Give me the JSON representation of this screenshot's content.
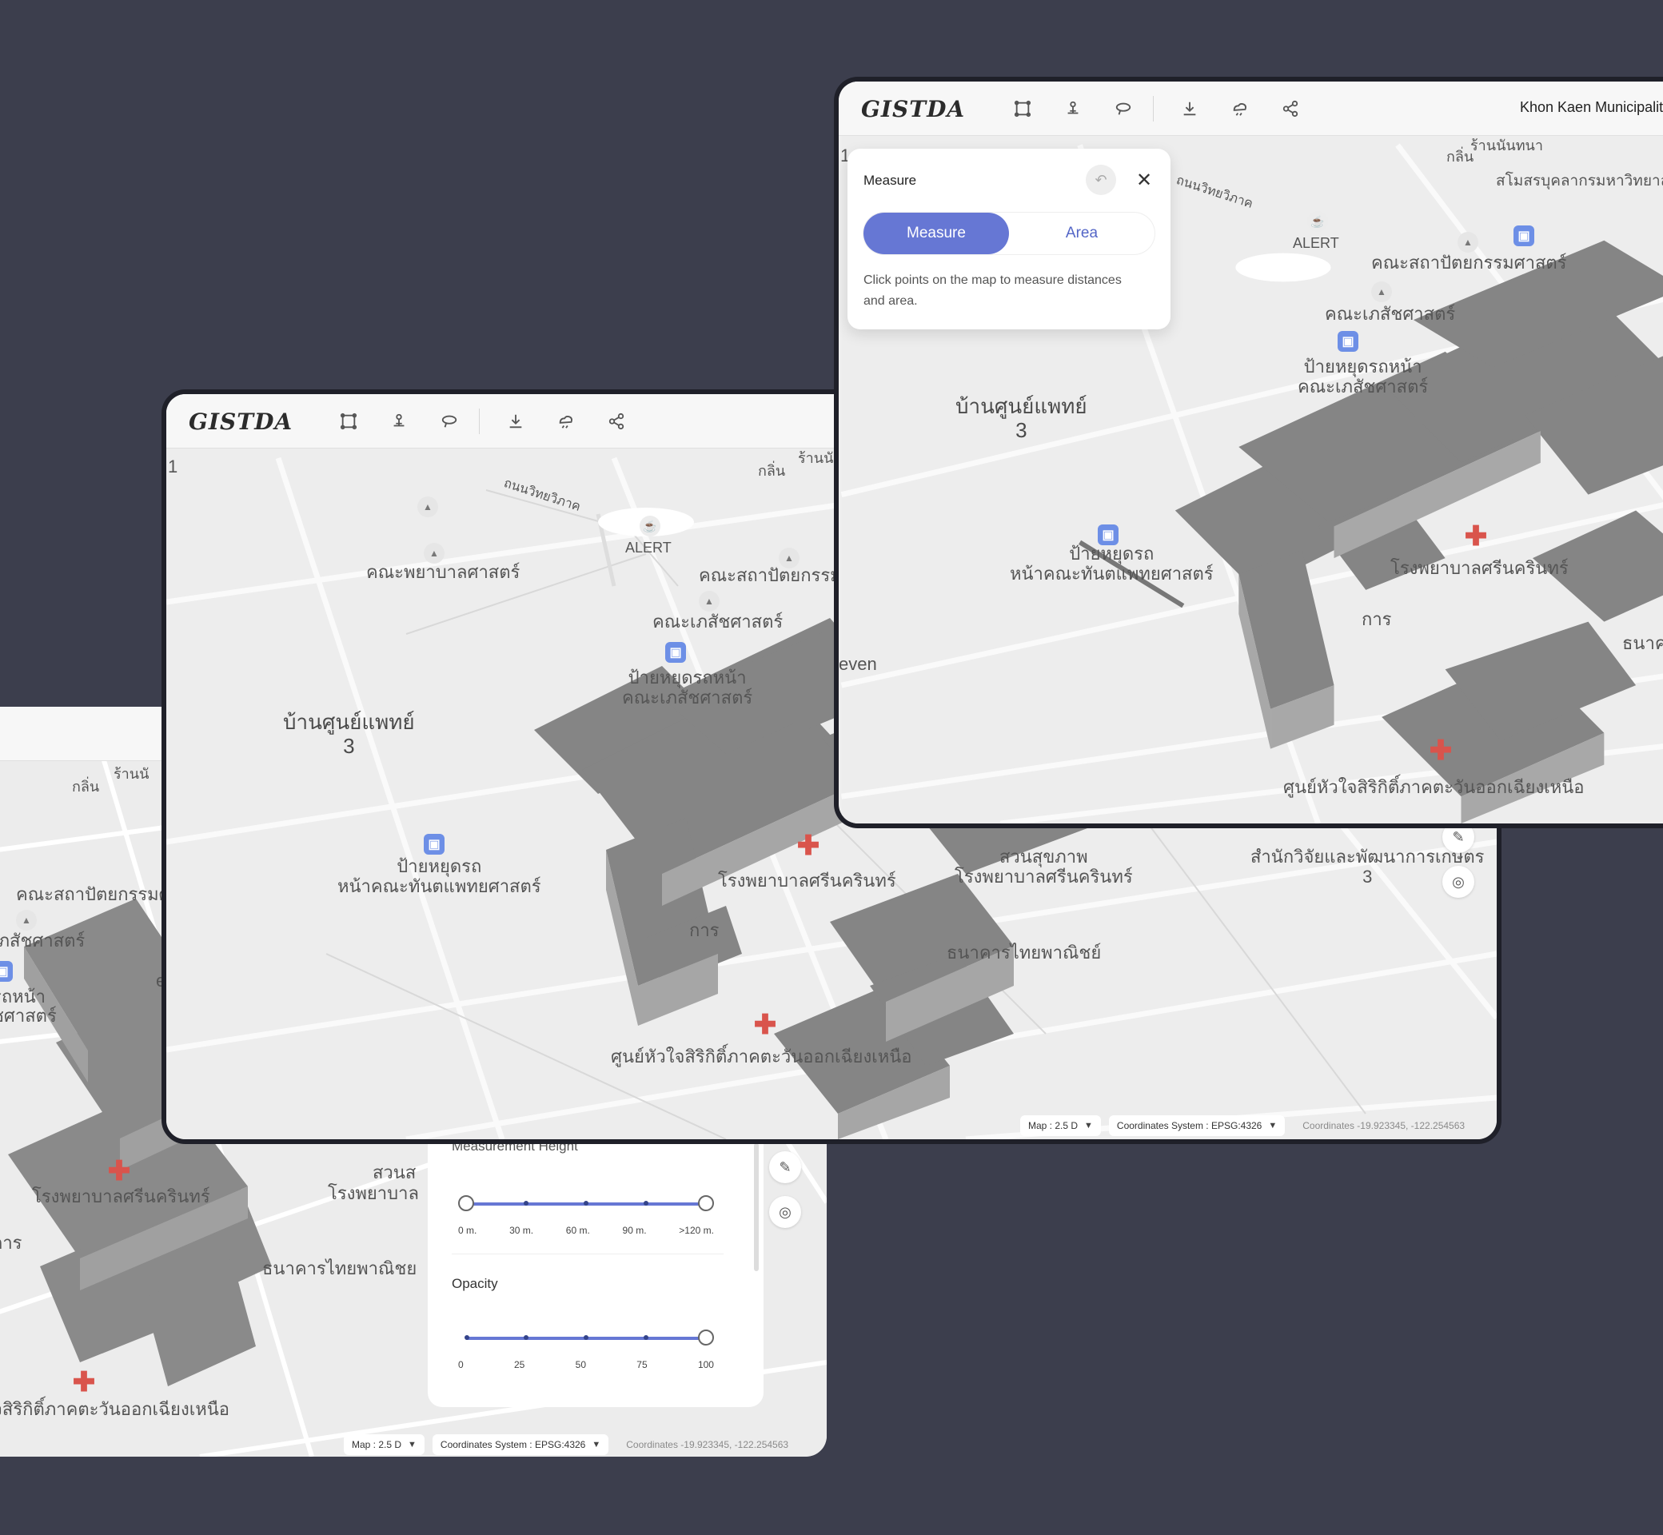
{
  "app": {
    "logo_text": "GISTDA",
    "region": "Khon Kaen Municipalit"
  },
  "toolbar": [
    "select-area-icon",
    "pin-icon",
    "lasso-icon",
    "download-icon",
    "weather-icon",
    "share-icon"
  ],
  "status": {
    "map_mode": "Map : 2.5 D",
    "coord_system": "Coordinates System : EPSG:4326",
    "coords": "Coordinates    -19.923345, -122.254563"
  },
  "map_labels": {
    "ban_sun_phaet": "บ้านศูนย์แพทย์",
    "ban_sun_phaet_num": "3",
    "alert": "ALERT",
    "khana_payaban": "คณะพยาบาลศาสตร์",
    "khana_sathapat": "คณะสถาปัตยกรรมศาสตร์",
    "khana_sathapat_cut": "คณะสถาปัตยกรรมศ",
    "khana_phesat": "คณะเภสัชศาสตร์",
    "bus_stop_phesat_1": "ป้ายหยุดรถหน้า",
    "bus_stop_phesat_2": "คณะเภสัชศาสตร์",
    "bus_stop_dent_1": "ป้ายหยุดรถ",
    "bus_stop_dent_2": "หน้าคณะทันตแพทยศาสตร์",
    "srinagarind": "โรงพยาบาลศรีนครินทร์",
    "heart_center": "ศูนย์หัวใจสิริกิติ์ภาคตะวันออกเฉียงเหนือ",
    "heart_center_cut": "จสิริกิติ์ภาคตะวันออกเฉียงเหนือ",
    "park_1": "สวนสุขภาพ",
    "park_2": "โรงพยาบาลศรีนครินทร์",
    "research": "สำนักวิจัยและพัฒนาการเกษตร",
    "research_num": "3",
    "thai_bank": "ธนาคารไทยพาณิชย์",
    "thai_bank_cut": "ธนาคารไทยพาณิชย",
    "seven": "even",
    "kan": "การ",
    "klin": "กลิ่น",
    "ran_nun": "ร้านนันทนา",
    "ran_nun_cut": "ร้านนั",
    "samosorn": "สโมสรบุคลากรมหาวิทยาลัย",
    "road": "ถนนวิทยวิภาค",
    "num_one": "1",
    "bus_cut_1": "รถหน้า",
    "bus_cut_2": "ชศาสตร์",
    "phesat_cut": "เภสัชศาสตร์",
    "samosorn_cut": "สโ",
    "park_cut": "สวนส",
    "park2_cut": "โรงพยาบาล",
    "thanon_cut": "ธนาค",
    "research_cut": "วิจัยและพัฒนาการเก",
    "kmm": "กาบ",
    "bank_cut2": "ธนาคารไทยพาณิชย์"
  },
  "layers_panel": {
    "measurement_height_title": "Measurement Height",
    "height_ticks": [
      "0 m.",
      "30 m.",
      "60 m.",
      "90 m.",
      ">120 m."
    ],
    "height_range": [
      0,
      120
    ],
    "opacity_title": "Opacity",
    "opacity_ticks": [
      "0",
      "25",
      "50",
      "75",
      "100"
    ],
    "opacity_value": 100
  },
  "measure_panel": {
    "title": "Measure",
    "tab_measure": "Measure",
    "tab_area": "Area",
    "help": "Click points on the map to measure distances and area."
  },
  "colors": {
    "accent": "#6677d4",
    "background": "#3c3e4d",
    "hospital": "#d9544c",
    "bus": "#6d8fe6"
  }
}
